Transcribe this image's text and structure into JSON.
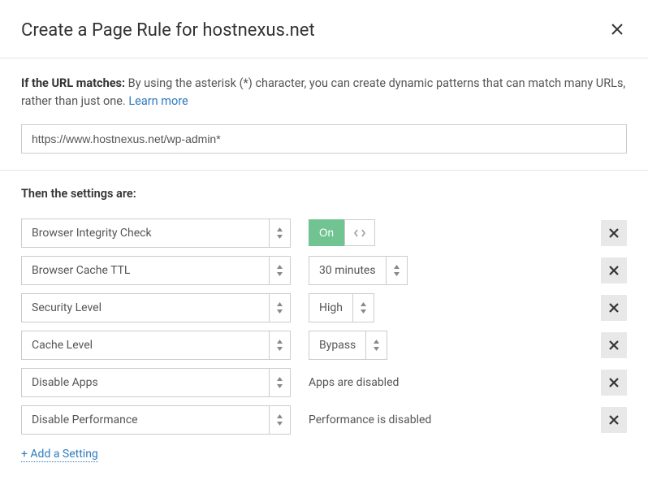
{
  "header": {
    "title": "Create a Page Rule for hostnexus.net"
  },
  "url_section": {
    "label_strong": "If the URL matches:",
    "help": " By using the asterisk (*) character, you can create dynamic patterns that can match many URLs, rather than just one. ",
    "learn_more": "Learn more",
    "input_value": "https://www.hostnexus.net/wp-admin*"
  },
  "settings": {
    "label": "Then the settings are:",
    "rows": [
      {
        "setting": "Browser Integrity Check",
        "type": "toggle",
        "value": "On"
      },
      {
        "setting": "Browser Cache TTL",
        "type": "select",
        "value": "30 minutes"
      },
      {
        "setting": "Security Level",
        "type": "select",
        "value": "High"
      },
      {
        "setting": "Cache Level",
        "type": "select",
        "value": "Bypass"
      },
      {
        "setting": "Disable Apps",
        "type": "text",
        "value": "Apps are disabled"
      },
      {
        "setting": "Disable Performance",
        "type": "text",
        "value": "Performance is disabled"
      }
    ],
    "add_label": "+ Add a Setting"
  }
}
